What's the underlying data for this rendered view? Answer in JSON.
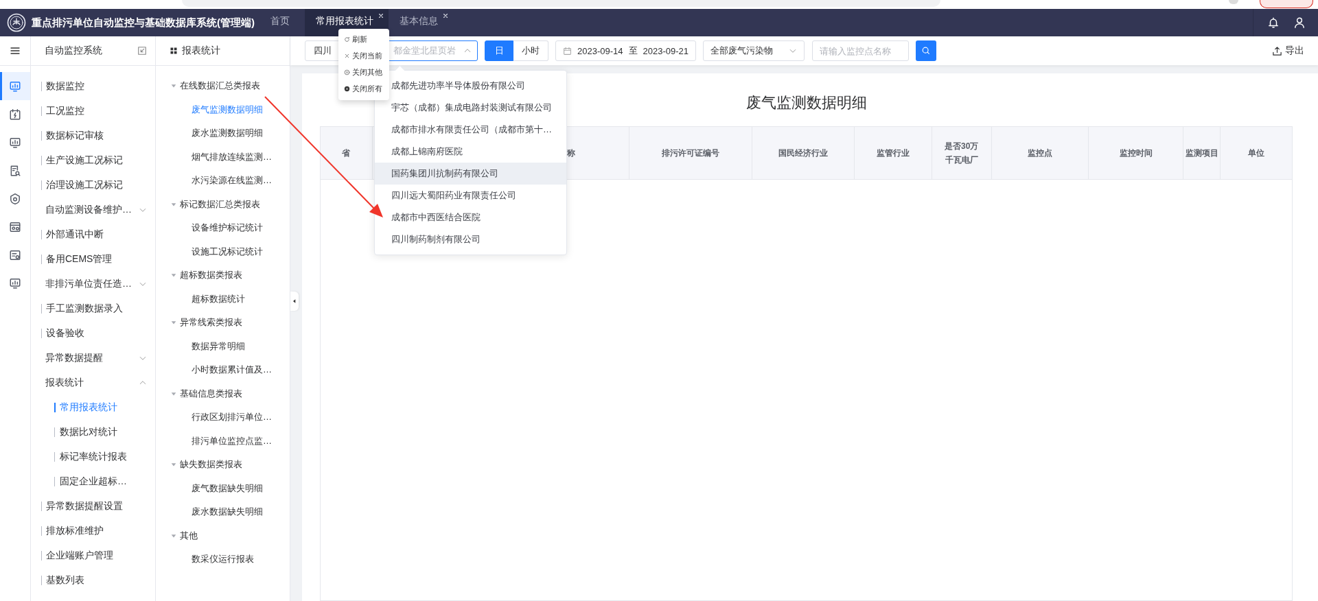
{
  "header": {
    "title": "重点排污单位自动监控与基础数据库系统(管理端)",
    "tabs": [
      {
        "label": "首页",
        "selected": false,
        "closable": false
      },
      {
        "label": "常用报表统计",
        "selected": true,
        "closable": true
      },
      {
        "label": "基本信息",
        "selected": false,
        "closable": true
      }
    ]
  },
  "context_menu": {
    "items": [
      {
        "label": "刷新",
        "kind": "refresh"
      },
      {
        "label": "关闭当前",
        "kind": "close"
      },
      {
        "label": "关闭其他",
        "kind": "close-others"
      },
      {
        "label": "关闭所有",
        "kind": "close-all"
      }
    ]
  },
  "icon_nav": {
    "items": [
      {
        "kind": "monitor-chart",
        "selected": true
      },
      {
        "kind": "calendar-bolt",
        "selected": false
      },
      {
        "kind": "monitor-chart",
        "selected": false
      },
      {
        "kind": "doc-search",
        "selected": false
      },
      {
        "kind": "shield-gear",
        "selected": false
      },
      {
        "kind": "card-gear",
        "selected": false
      },
      {
        "kind": "list-gear",
        "selected": false
      },
      {
        "kind": "monitor-chart",
        "selected": false
      }
    ]
  },
  "menu": {
    "title": "自动监控系统",
    "items": [
      {
        "label": "数据监控",
        "kind": "leaf",
        "selected": false
      },
      {
        "label": "工况监控",
        "kind": "leaf",
        "selected": false
      },
      {
        "label": "数据标记审核",
        "kind": "leaf",
        "selected": false
      },
      {
        "label": "生产设施工况标记",
        "kind": "leaf",
        "selected": false
      },
      {
        "label": "治理设施工况标记",
        "kind": "leaf",
        "selected": false
      },
      {
        "label": "自动监测设备维护…",
        "kind": "group",
        "expanded": false
      },
      {
        "label": "外部通讯中断",
        "kind": "leaf",
        "selected": false
      },
      {
        "label": "备用CEMS管理",
        "kind": "leaf",
        "selected": false
      },
      {
        "label": "非排污单位责任造…",
        "kind": "group",
        "expanded": false
      },
      {
        "label": "手工监测数据录入",
        "kind": "leaf",
        "selected": false
      },
      {
        "label": "设备验收",
        "kind": "leaf",
        "selected": false
      },
      {
        "label": "异常数据提醒",
        "kind": "group",
        "expanded": false
      },
      {
        "label": "报表统计",
        "kind": "group",
        "expanded": true,
        "children": [
          {
            "label": "常用报表统计",
            "kind": "leaf",
            "selected": true
          },
          {
            "label": "数据比对统计",
            "kind": "leaf",
            "selected": false
          },
          {
            "label": "标记率统计报表",
            "kind": "leaf",
            "selected": false
          },
          {
            "label": "固定企业超标…",
            "kind": "leaf",
            "selected": false
          }
        ]
      },
      {
        "label": "异常数据提醒设置",
        "kind": "leaf",
        "selected": false
      },
      {
        "label": "排放标准维护",
        "kind": "leaf",
        "selected": false
      },
      {
        "label": "企业端账户管理",
        "kind": "leaf",
        "selected": false
      },
      {
        "label": "基数列表",
        "kind": "leaf",
        "selected": false
      }
    ]
  },
  "report_tree": {
    "title": "报表统计",
    "groups": [
      {
        "label": "在线数据汇总类报表",
        "expanded": true,
        "items": [
          {
            "label": "废气监测数据明细",
            "selected": true
          },
          {
            "label": "废水监测数据明细",
            "selected": false
          },
          {
            "label": "烟气排放连续监测…",
            "selected": false
          },
          {
            "label": "水污染源在线监测…",
            "selected": false
          }
        ]
      },
      {
        "label": "标记数据汇总类报表",
        "expanded": true,
        "items": [
          {
            "label": "设备维护标记统计",
            "selected": false
          },
          {
            "label": "设施工况标记统计",
            "selected": false
          }
        ]
      },
      {
        "label": "超标数据类报表",
        "expanded": true,
        "items": [
          {
            "label": "超标数据统计",
            "selected": false
          }
        ]
      },
      {
        "label": "异常线索类报表",
        "expanded": true,
        "items": [
          {
            "label": "数据异常明细",
            "selected": false
          },
          {
            "label": "小时数据累计值及…",
            "selected": false
          }
        ]
      },
      {
        "label": "基础信息类报表",
        "expanded": true,
        "items": [
          {
            "label": "行政区划排污单位…",
            "selected": false
          },
          {
            "label": "排污单位监控点监…",
            "selected": false
          }
        ]
      },
      {
        "label": "缺失数据类报表",
        "expanded": true,
        "items": [
          {
            "label": "废气数据缺失明细",
            "selected": false
          },
          {
            "label": "废水数据缺失明细",
            "selected": false
          }
        ]
      },
      {
        "label": "其他",
        "expanded": true,
        "items": [
          {
            "label": "数采仪运行报表",
            "selected": false
          }
        ]
      }
    ]
  },
  "filters": {
    "region": "四川",
    "company_select": {
      "value": "都金堂北星页岩",
      "open": true
    },
    "granularity": [
      {
        "label": "日",
        "selected": true
      },
      {
        "label": "小时",
        "selected": false
      }
    ],
    "date_from": "2023-09-14",
    "date_separator": "至",
    "date_to": "2023-09-21",
    "pollutant": "全部废气污染物",
    "point_search": {
      "placeholder": "请输入监控点名称"
    },
    "export": "导出"
  },
  "company_dropdown": {
    "items": [
      {
        "label": "成都先进功率半导体股份有限公司",
        "hovered": false
      },
      {
        "label": "宇芯（成都）集成电路封装测试有限公司",
        "hovered": false
      },
      {
        "label": "成都市排水有限责任公司（成都市第十…",
        "hovered": false
      },
      {
        "label": "成都上锦南府医院",
        "hovered": false
      },
      {
        "label": "国药集团川抗制药有限公司",
        "hovered": true
      },
      {
        "label": "四川远大蜀阳药业有限责任公司",
        "hovered": false
      },
      {
        "label": "成都市中西医结合医院",
        "hovered": false
      },
      {
        "label": "四川制药制剂有限公司",
        "hovered": false
      }
    ]
  },
  "report": {
    "title": "废气监测数据明细",
    "columns": [
      "省",
      "称",
      "排污许可证编号",
      "国民经济行业",
      "监管行业",
      "是否30万千瓦电厂",
      "监控点",
      "监控时间",
      "监测项目",
      "单位"
    ]
  }
}
